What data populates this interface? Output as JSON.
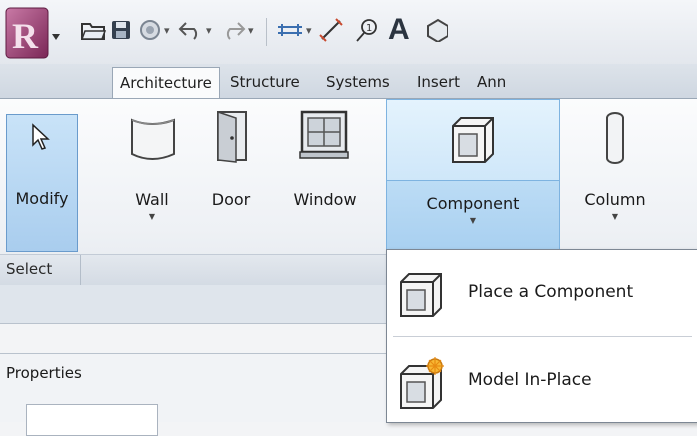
{
  "app": {
    "icon": "revit-app-icon"
  },
  "quick_access": {
    "icons": [
      "open-folder-icon",
      "save-icon",
      "sync-icon",
      "undo-icon",
      "redo-icon",
      "measure-icon",
      "dimension-icon",
      "tag-icon",
      "text-icon",
      "view-3d-icon"
    ],
    "text_tool_label": "A"
  },
  "tabs": [
    "Architecture",
    "Structure",
    "Systems",
    "Insert",
    "Ann"
  ],
  "active_tab": "Architecture",
  "ribbon": {
    "buttons": {
      "modify": "Modify",
      "wall": "Wall",
      "door": "Door",
      "window": "Window",
      "component": "Component",
      "column": "Column"
    },
    "panel_select": "Select"
  },
  "dropdown": {
    "items": [
      "Place a Component",
      "Model In-Place"
    ]
  },
  "properties": {
    "title": "Properties"
  },
  "colors": {
    "accent": "#a9cdee",
    "highlight": "#d4ebfb",
    "border": "#7eb3e0"
  }
}
